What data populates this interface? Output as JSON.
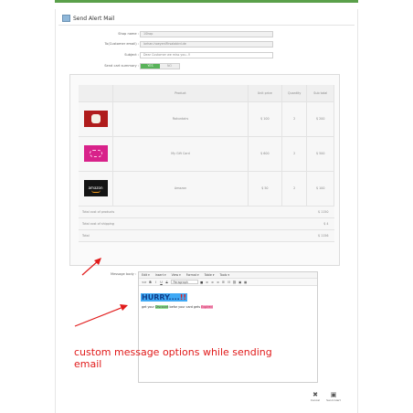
{
  "header": {
    "title": "Send Alert Mail"
  },
  "form": {
    "shop_name": {
      "label": "Shop name :",
      "value": "1Shop"
    },
    "to_email": {
      "label": "To(Customer email) :",
      "value": "lorhan.hoeyenlFirsalabird.de"
    },
    "subject": {
      "label": "Subject :",
      "value": "Dear Customer we miss you..!!"
    },
    "send_cart_summary": {
      "label": "Send cart summary :",
      "yes": "YES",
      "no": "NO",
      "selected": "YES"
    }
  },
  "cart_table": {
    "headers": [
      "",
      "Product",
      "Unit price",
      "Quantity",
      "Sub total"
    ],
    "rows": [
      {
        "image": "puppy-gift-card",
        "product": "Rakuntairs",
        "unit_price": "$ 100",
        "quantity": "2",
        "subtotal": "$ 200"
      },
      {
        "image": "pink-gift-card",
        "product": "My Gift Card",
        "unit_price": "$ 600",
        "quantity": "2",
        "subtotal": "$ 500"
      },
      {
        "image": "amazon-gift-card",
        "product": "Amazon",
        "unit_price": "$ 50",
        "quantity": "2",
        "subtotal": "$ 100"
      }
    ],
    "totals": [
      {
        "label": "Total cost of products",
        "value": "$ 1150"
      },
      {
        "label": "Total cost of shipping",
        "value": "$ 4"
      },
      {
        "label": "Total",
        "value": "$ 1156"
      }
    ],
    "amazon_text": "amazon"
  },
  "message": {
    "label": "Message body :",
    "menus": [
      "Edit ▾",
      "Insert ▾",
      "View ▾",
      "Format ▾",
      "Table ▾",
      "Tools ▾"
    ],
    "toolbar": {
      "code": "<>",
      "bold": "B",
      "italic": "I",
      "underline": "U",
      "strike": "S",
      "format_select": "Paragraph"
    },
    "heading": "HURRY....",
    "heading_bang": "!!",
    "body_pre": "get your ",
    "body_hl1": "Discount",
    "body_mid": " befor your card gets ",
    "body_hl2": "Expired"
  },
  "annotation": {
    "callout": "custom message options while sending email"
  },
  "actions": {
    "cancel": "Cancel",
    "send": "Send Alert"
  },
  "colors": {
    "accent_green": "#59b35a",
    "annotation_red": "#e11b1b",
    "heading_bg": "#3fa9f5"
  }
}
